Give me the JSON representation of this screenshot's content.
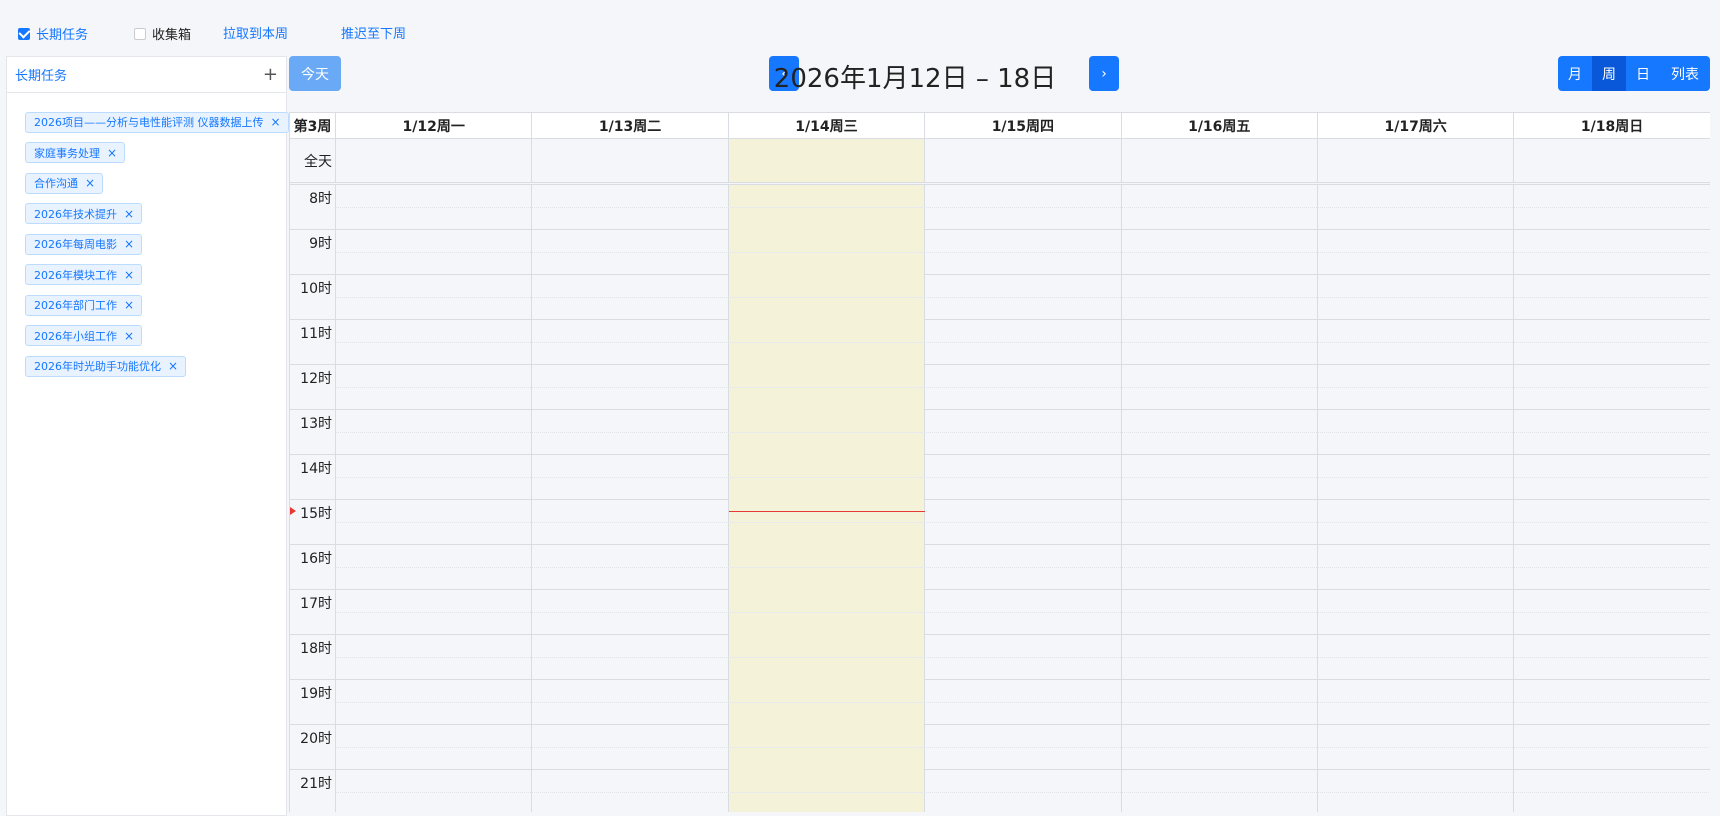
{
  "topbar": {
    "long_term_label": "长期任务",
    "long_term_checked": true,
    "inbox_label": "收集箱",
    "inbox_checked": false,
    "pull_link": "拉取到本周",
    "defer_link": "推迟至下周"
  },
  "sidebar": {
    "title": "长期任务",
    "add_icon": "plus-icon",
    "tags": [
      {
        "label": "2026项目——分析与电性能评测 仪器数据上传"
      },
      {
        "label": "家庭事务处理"
      },
      {
        "label": "合作沟通"
      },
      {
        "label": "2026年技术提升"
      },
      {
        "label": "2026年每周电影"
      },
      {
        "label": "2026年模块工作"
      },
      {
        "label": "2026年部门工作"
      },
      {
        "label": "2026年小组工作"
      },
      {
        "label": "2026年时光助手功能优化"
      }
    ],
    "tag_close_glyph": "×"
  },
  "calendar": {
    "today_label": "今天",
    "prev_glyph": "‹",
    "next_glyph": "›",
    "title": "2026年1月12日 – 18日",
    "views": [
      {
        "label": "月",
        "active": false
      },
      {
        "label": "周",
        "active": true
      },
      {
        "label": "日",
        "active": false
      },
      {
        "label": "列表",
        "active": false
      }
    ],
    "week_label": "第3周",
    "allday_label": "全天",
    "days": [
      "1/12周一",
      "1/13周二",
      "1/14周三",
      "1/15周四",
      "1/16周五",
      "1/17周六",
      "1/18周日"
    ],
    "today_index": 2,
    "hours": [
      "8时",
      "9时",
      "10时",
      "11时",
      "12时",
      "13时",
      "14时",
      "15时",
      "16时",
      "17时",
      "18时",
      "19时",
      "20时",
      "21时"
    ],
    "now_time": "15:05",
    "colors": {
      "accent": "#1677ff",
      "today_bg": "#f5f2da",
      "now_indicator": "#e53935"
    }
  }
}
